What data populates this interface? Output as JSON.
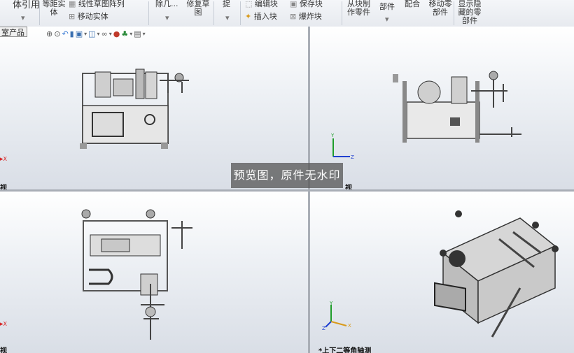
{
  "toolbar": {
    "col1": {
      "line1": "体引用",
      "line2": ""
    },
    "col2": {
      "line1": "等距实",
      "line2": "体"
    },
    "linear_pattern": "线性草图阵列",
    "move_entity": "移动实体",
    "col4": {
      "line1": "除几...",
      "line2": ""
    },
    "repair": {
      "line1": "修复草",
      "line2": "图"
    },
    "col6": {
      "line1": "捉",
      "line2": ""
    },
    "edit_block": "编辑块",
    "save_block": "保存块",
    "insert_block": "插入块",
    "explode_block": "爆炸块",
    "from_block": {
      "line1": "从块制",
      "line2": "作零件"
    },
    "parts": "部件",
    "mate": "配合",
    "move_part": {
      "line1": "移动零",
      "line2": "部件"
    },
    "show_hide": {
      "line1": "显示隐",
      "line2": "藏的零",
      "line3": "部件"
    }
  },
  "document_tab": "室产品",
  "views": {
    "top_left": {
      "label": "视",
      "axis": "X"
    },
    "top_right": {
      "label": "视",
      "axis_y": "Y",
      "axis_z": "Z"
    },
    "bottom_left": {
      "label": "视",
      "axis": "X"
    },
    "bottom_right": {
      "label": "*上下二等角轴测",
      "axis_y": "Y",
      "axis_z": "Z",
      "axis_x": "X"
    }
  },
  "watermark": "预览图，原件无水印",
  "colors": {
    "accent": "#1f5fb4",
    "axis_red": "#d62020",
    "axis_green": "#1f9d2a",
    "axis_blue": "#2040d0"
  }
}
